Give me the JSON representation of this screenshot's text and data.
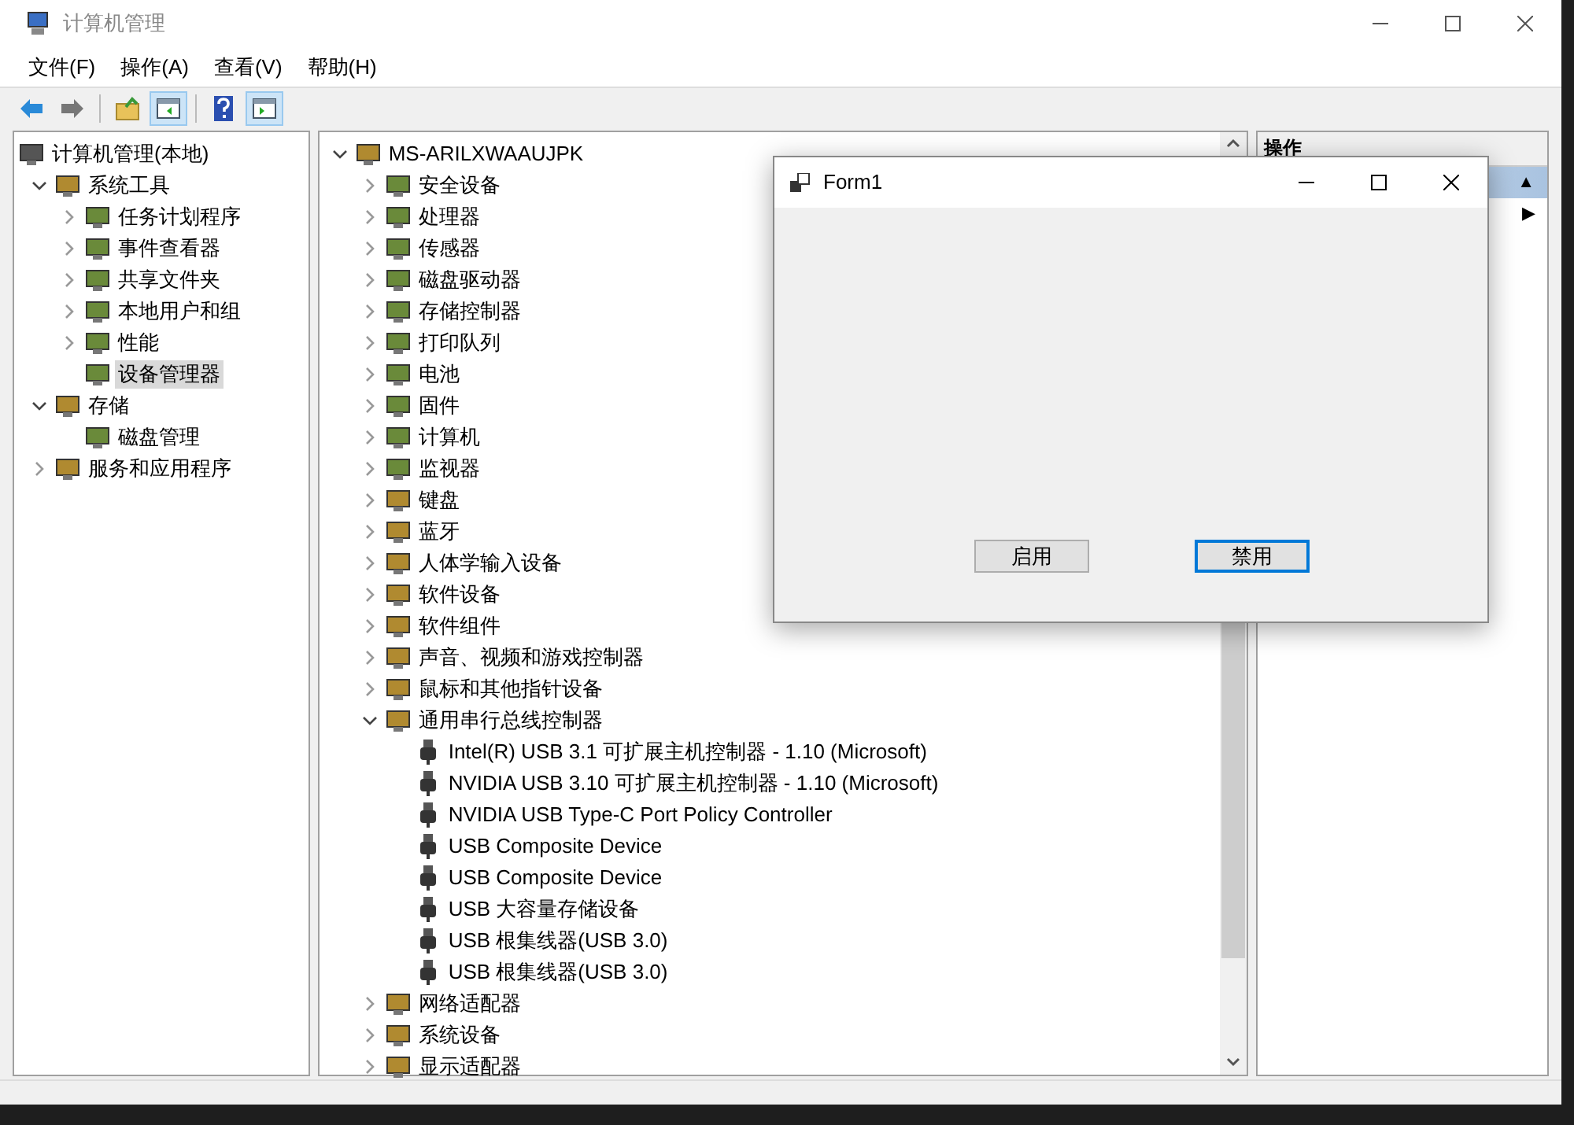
{
  "window": {
    "title": "计算机管理"
  },
  "menu": [
    "文件(F)",
    "操作(A)",
    "查看(V)",
    "帮助(H)"
  ],
  "toolbar": [
    {
      "kind": "back",
      "pressed": false
    },
    {
      "kind": "forward",
      "pressed": false
    },
    {
      "kind": "up",
      "pressed": false
    },
    {
      "kind": "tree",
      "pressed": true
    },
    {
      "kind": "help",
      "pressed": false
    },
    {
      "kind": "action",
      "pressed": true
    }
  ],
  "console_tree": [
    {
      "label": "计算机管理(本地)",
      "selected": false,
      "children": [
        {
          "label": "系统工具",
          "expanded": true,
          "selected": false,
          "children": [
            {
              "label": "任务计划程序",
              "expanded": false,
              "selected": false
            },
            {
              "label": "事件查看器",
              "expanded": false,
              "selected": false
            },
            {
              "label": "共享文件夹",
              "expanded": false,
              "selected": false
            },
            {
              "label": "本地用户和组",
              "expanded": false,
              "selected": false
            },
            {
              "label": "性能",
              "expanded": false,
              "selected": false
            },
            {
              "label": "设备管理器",
              "selected": true
            }
          ]
        },
        {
          "label": "存储",
          "expanded": true,
          "selected": false,
          "children": [
            {
              "label": "磁盘管理",
              "selected": false
            }
          ]
        },
        {
          "label": "服务和应用程序",
          "expanded": false,
          "selected": false
        }
      ]
    }
  ],
  "device_tree": [
    {
      "label": "MS-ARILXWAAUJPK",
      "expanded": true,
      "children": [
        {
          "label": "安全设备",
          "expanded": false
        },
        {
          "label": "处理器",
          "expanded": false
        },
        {
          "label": "传感器",
          "expanded": false
        },
        {
          "label": "磁盘驱动器",
          "expanded": false
        },
        {
          "label": "存储控制器",
          "expanded": false
        },
        {
          "label": "打印队列",
          "expanded": false
        },
        {
          "label": "电池",
          "expanded": false
        },
        {
          "label": "固件",
          "expanded": false
        },
        {
          "label": "计算机",
          "expanded": false
        },
        {
          "label": "监视器",
          "expanded": false
        },
        {
          "label": "键盘",
          "expanded": false
        },
        {
          "label": "蓝牙",
          "expanded": false
        },
        {
          "label": "人体学输入设备",
          "expanded": false
        },
        {
          "label": "软件设备",
          "expanded": false
        },
        {
          "label": "软件组件",
          "expanded": false
        },
        {
          "label": "声音、视频和游戏控制器",
          "expanded": false
        },
        {
          "label": "鼠标和其他指针设备",
          "expanded": false
        },
        {
          "label": "通用串行总线控制器",
          "expanded": true,
          "children": [
            {
              "label": "Intel(R) USB 3.1 可扩展主机控制器 - 1.10 (Microsoft)"
            },
            {
              "label": "NVIDIA USB 3.10 可扩展主机控制器 - 1.10 (Microsoft)"
            },
            {
              "label": "NVIDIA USB Type-C Port Policy Controller"
            },
            {
              "label": "USB Composite Device"
            },
            {
              "label": "USB Composite Device"
            },
            {
              "label": "USB 大容量存储设备"
            },
            {
              "label": "USB 根集线器(USB 3.0)"
            },
            {
              "label": "USB 根集线器(USB 3.0)"
            }
          ]
        },
        {
          "label": "网络适配器",
          "expanded": false
        },
        {
          "label": "系统设备",
          "expanded": false
        },
        {
          "label": "显示适配器",
          "expanded": false
        }
      ]
    }
  ],
  "actions": {
    "header": "操作",
    "rows": [
      {
        "selected": true,
        "arrow": "▲"
      },
      {
        "selected": false,
        "arrow": "▶"
      }
    ]
  },
  "form": {
    "title": "Form1",
    "buttons": [
      {
        "label": "启用",
        "focused": false
      },
      {
        "label": "禁用",
        "focused": true
      }
    ]
  }
}
